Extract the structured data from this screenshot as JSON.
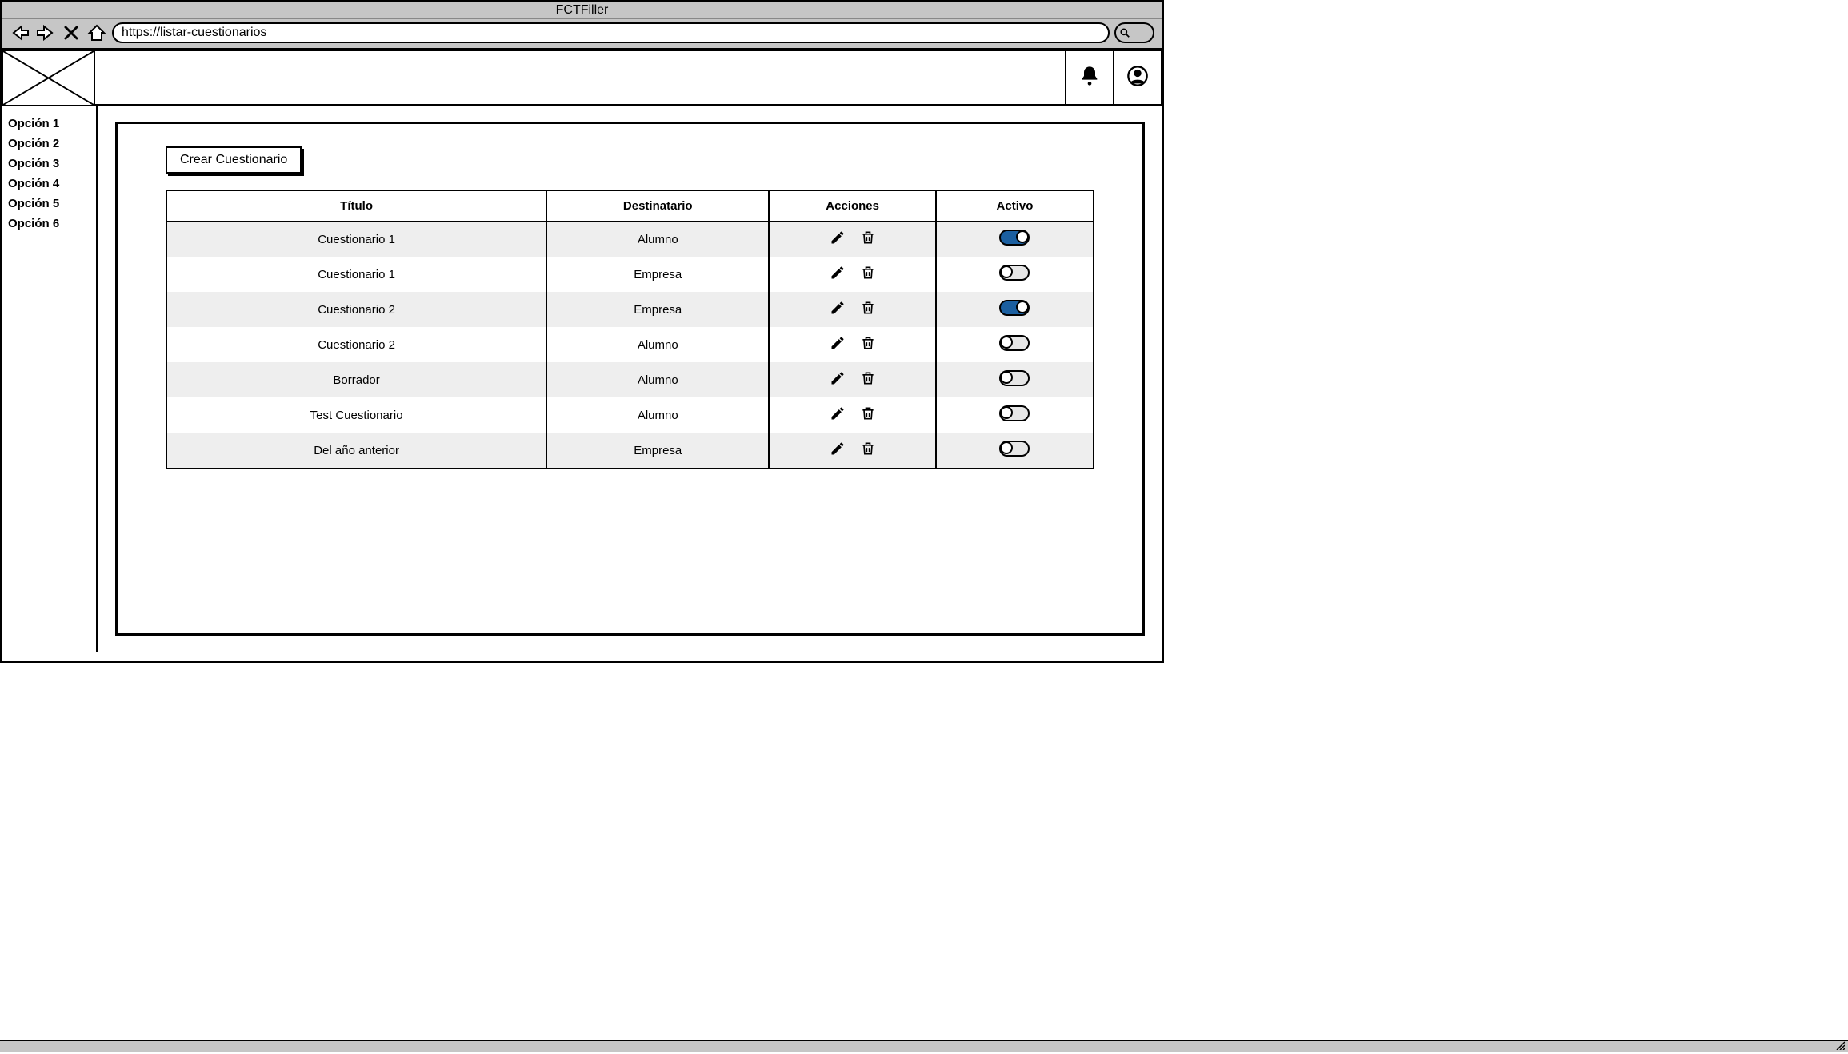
{
  "browser": {
    "title": "FCTFiller",
    "url": "https://listar-cuestionarios"
  },
  "sidebar": {
    "items": [
      {
        "label": "Opción 1"
      },
      {
        "label": "Opción 2"
      },
      {
        "label": "Opción 3"
      },
      {
        "label": "Opción 4"
      },
      {
        "label": "Opción 5"
      },
      {
        "label": "Opción 6"
      }
    ]
  },
  "main": {
    "create_button_label": "Crear Cuestionario",
    "table": {
      "headers": {
        "title": "Título",
        "recipient": "Destinatario",
        "actions": "Acciones",
        "active": "Activo"
      },
      "rows": [
        {
          "title": "Cuestionario 1",
          "recipient": "Alumno",
          "active": true
        },
        {
          "title": "Cuestionario 1",
          "recipient": "Empresa",
          "active": false
        },
        {
          "title": "Cuestionario 2",
          "recipient": "Empresa",
          "active": true
        },
        {
          "title": "Cuestionario 2",
          "recipient": "Alumno",
          "active": false
        },
        {
          "title": "Borrador",
          "recipient": "Alumno",
          "active": false
        },
        {
          "title": "Test Cuestionario",
          "recipient": "Alumno",
          "active": false
        },
        {
          "title": "Del año anterior",
          "recipient": "Empresa",
          "active": false
        }
      ]
    }
  },
  "colors": {
    "toggle_on": "#1b5fa0",
    "chrome_bg": "#c6c6c6",
    "row_alt": "#eeeeee"
  }
}
